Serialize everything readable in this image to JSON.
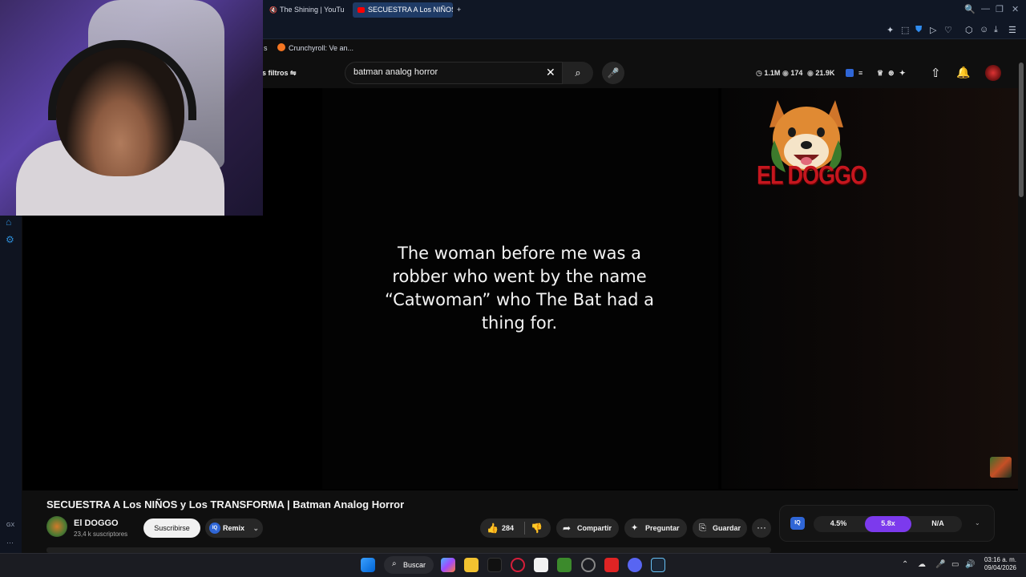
{
  "browser": {
    "tabs": [
      {
        "label": "The Shining | YouTube"
      },
      {
        "label": "SECUESTRA A Los NIÑOS"
      }
    ],
    "new_tab": "+",
    "bookmark_partial": "s",
    "bookmark_crunchyroll": "Crunchyroll: Ve an...",
    "window_controls": {
      "search": "🔍",
      "minimize": "—",
      "restore": "❐",
      "close": "✕"
    }
  },
  "gx_sidebar": {
    "label_gx": "GX",
    "label_more": "···"
  },
  "youtube": {
    "filters_label": "s filtros",
    "search": {
      "value": "batman analog horror",
      "clear": "✕",
      "icon": "⌕",
      "mic": "🎤"
    },
    "stats": {
      "views": "1.1M",
      "watching": "174",
      "likes": "21.9K"
    },
    "video": {
      "caption": "The woman before me was a robber who went by the name “Catwoman” who The Bat had a thing for.",
      "logo_text": "EL DOGGO",
      "title": "SECUESTRA A Los NIÑOS y Los TRANSFORMA | Batman Analog Horror",
      "channel": "El DOGGO",
      "subscribers": "23,4 k suscriptores",
      "subscribe": "Suscribirse",
      "remix": "Remix",
      "remix_icon": "IQ",
      "likes": "284",
      "share": "Compartir",
      "ask": "Preguntar",
      "save": "Guardar",
      "more": "···"
    },
    "speed_panel": {
      "logo": "IQ",
      "values": [
        "4.5%",
        "5.8x",
        "N/A"
      ],
      "active_index": 1
    }
  },
  "taskbar": {
    "search_label": "Buscar",
    "time": "03:16 a. m.",
    "date": "09/04/2026",
    "accent": "#7c3aed"
  }
}
